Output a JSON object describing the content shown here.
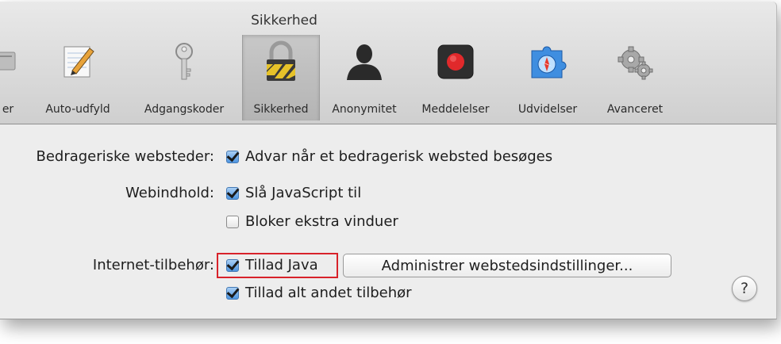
{
  "window": {
    "title": "Sikkerhed"
  },
  "toolbar": {
    "items": [
      {
        "label": "er",
        "icon": "general-icon"
      },
      {
        "label": "Auto-udfyld",
        "icon": "pencil-document-icon"
      },
      {
        "label": "Adgangskoder",
        "icon": "key-icon"
      },
      {
        "label": "Sikkerhed",
        "icon": "padlock-icon",
        "selected": true
      },
      {
        "label": "Anonymitet",
        "icon": "person-silhouette-icon"
      },
      {
        "label": "Meddelelser",
        "icon": "notification-record-icon"
      },
      {
        "label": "Udvidelser",
        "icon": "puzzle-compass-icon"
      },
      {
        "label": "Avanceret",
        "icon": "gears-icon"
      }
    ]
  },
  "settings": {
    "fraud": {
      "label": "Bedrageriske websteder:",
      "checkbox": {
        "label": "Advar når et bedragerisk websted besøges",
        "checked": true
      }
    },
    "web_content": {
      "label": "Webindhold:",
      "javascript": {
        "label": "Slå JavaScript til",
        "checked": true
      },
      "popups": {
        "label": "Bloker ekstra vinduer",
        "checked": false
      }
    },
    "plugins": {
      "label": "Internet-tilbehør:",
      "java": {
        "label": "Tillad Java",
        "checked": true
      },
      "manage_button": "Administrer webstedsindstillinger...",
      "other": {
        "label": "Tillad alt andet tilbehør",
        "checked": true
      }
    }
  },
  "help_button": "?",
  "colors": {
    "highlight_border": "#d8222a",
    "checkbox_blue": "#4e95e0",
    "toolbar_gradient_top": "#e9e9e9",
    "toolbar_gradient_bottom": "#cfcfcf"
  }
}
